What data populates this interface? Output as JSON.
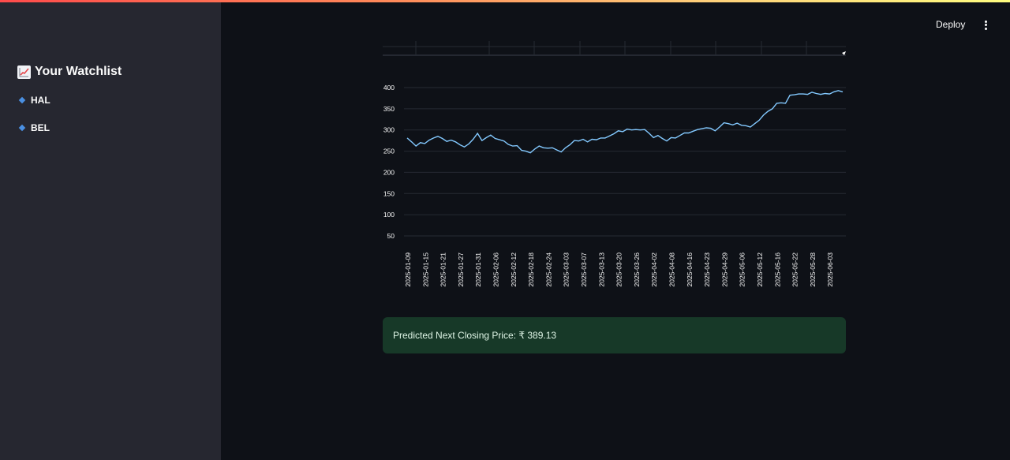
{
  "sidebar": {
    "title": "Your Watchlist",
    "title_icon": "chart-increasing-icon",
    "items": [
      {
        "label": "HAL",
        "icon": "diamond-icon"
      },
      {
        "label": "BEL",
        "icon": "diamond-icon"
      }
    ]
  },
  "header": {
    "deploy_label": "Deploy",
    "menu_icon": "vertical-ellipsis-icon"
  },
  "prediction": {
    "text": "Predicted Next Closing Price: ₹ 389.13"
  },
  "colors": {
    "line": "#83c9ff",
    "grid": "#262a33",
    "success_bg": "#173928"
  },
  "chart_data": {
    "type": "line",
    "title": "",
    "xlabel": "",
    "ylabel": "",
    "ylim": [
      50,
      400
    ],
    "yticks": [
      50,
      100,
      150,
      200,
      250,
      300,
      350,
      400
    ],
    "xtick_labels": [
      "2025-01-09",
      "2025-01-15",
      "2025-01-21",
      "2025-01-27",
      "2025-01-31",
      "2025-02-06",
      "2025-02-12",
      "2025-02-18",
      "2025-02-24",
      "2025-03-03",
      "2025-03-07",
      "2025-03-13",
      "2025-03-20",
      "2025-03-26",
      "2025-04-02",
      "2025-04-08",
      "2025-04-16",
      "2025-04-23",
      "2025-04-29",
      "2025-05-06",
      "2025-05-12",
      "2025-05-16",
      "2025-05-22",
      "2025-05-28",
      "2025-06-03"
    ],
    "series": [
      {
        "values": [
          281,
          272,
          262,
          270,
          268,
          276,
          281,
          285,
          280,
          273,
          276,
          272,
          265,
          260,
          267,
          278,
          292,
          275,
          282,
          288,
          280,
          277,
          274,
          266,
          262,
          263,
          252,
          250,
          246,
          255,
          262,
          258,
          257,
          258,
          253,
          248,
          258,
          265,
          275,
          274,
          278,
          272,
          278,
          277,
          281,
          281,
          286,
          291,
          298,
          296,
          302,
          300,
          301,
          300,
          301,
          292,
          282,
          287,
          280,
          274,
          282,
          281,
          287,
          293,
          293,
          297,
          301,
          303,
          305,
          304,
          298,
          307,
          317,
          315,
          312,
          316,
          311,
          310,
          307,
          315,
          323,
          335,
          344,
          350,
          363,
          364,
          363,
          382,
          383,
          385,
          385,
          384,
          389,
          386,
          384,
          386,
          385,
          390,
          393,
          390
        ]
      }
    ]
  }
}
